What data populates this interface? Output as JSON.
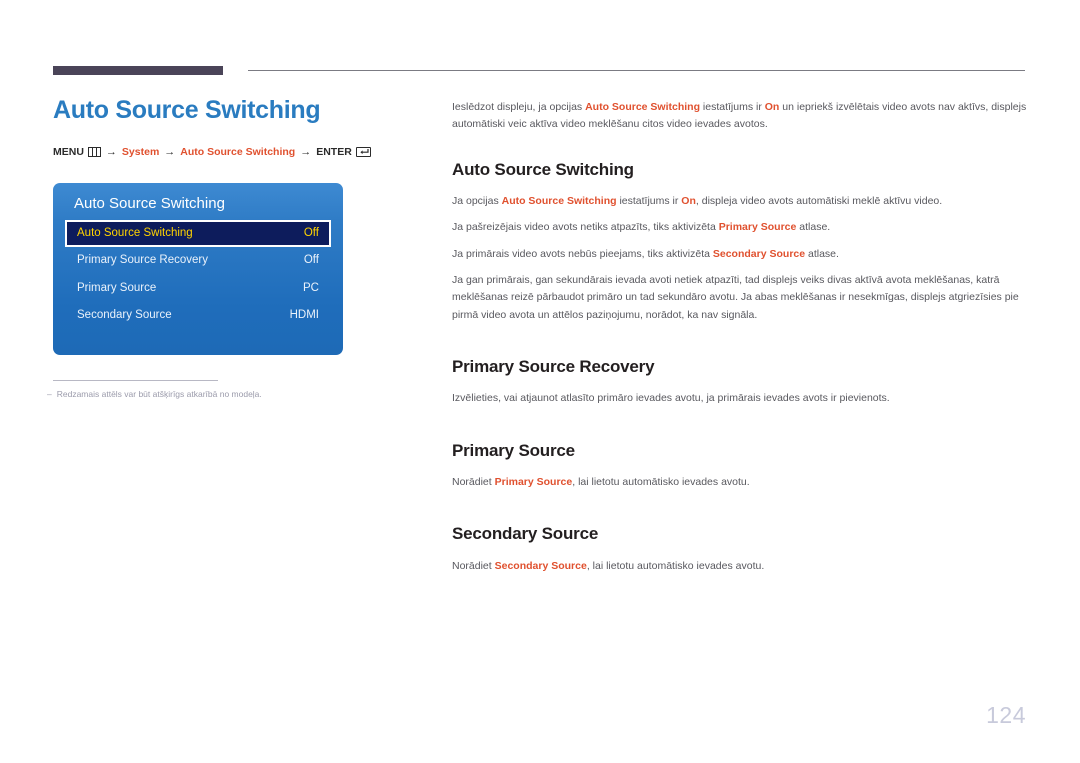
{
  "page": {
    "title": "Auto Source Switching",
    "number": "124"
  },
  "breadcrumb": {
    "menu_label": "MENU",
    "menu_icon": "menu-grid-icon",
    "arrow": "→",
    "step1": "System",
    "step2": "Auto Source Switching",
    "enter_label": "ENTER",
    "enter_icon": "enter-return-icon"
  },
  "osd": {
    "title": "Auto Source Switching",
    "rows": [
      {
        "label": "Auto Source Switching",
        "value": "Off",
        "selected": true
      },
      {
        "label": "Primary Source Recovery",
        "value": "Off",
        "selected": false
      },
      {
        "label": "Primary Source",
        "value": "PC",
        "selected": false
      },
      {
        "label": "Secondary Source",
        "value": "HDMI",
        "selected": false
      }
    ]
  },
  "footnote": {
    "dash": "–",
    "text": "Redzamais attēls var būt atšķirīgs atkarībā no modeļa."
  },
  "content": {
    "intro": {
      "p1": "Ieslēdzot displeju, ja opcijas ",
      "hl1": "Auto Source Switching",
      "p2": " iestatījums ir ",
      "hl2": "On",
      "p3": " un iepriekš izvēlētais video avots nav aktīvs, displejs automātiski veic aktīva video meklēšanu citos video ievades avotos."
    },
    "sections": [
      {
        "heading": "Auto Source Switching",
        "line1_a": "Ja opcijas ",
        "line1_hl1": "Auto Source Switching",
        "line1_b": " iestatījums ir ",
        "line1_hl2": "On",
        "line1_c": ", displeja video avots automātiski meklē aktīvu video.",
        "line2_a": "Ja pašreizējais video avots netiks atpazīts, tiks aktivizēta ",
        "line2_hl": "Primary Source",
        "line2_b": " atlase.",
        "line3_a": "Ja primārais video avots nebūs pieejams, tiks aktivizēta ",
        "line3_hl": "Secondary Source",
        "line3_b": " atlase.",
        "para": "Ja gan primārais, gan sekundārais ievada avoti netiek atpazīti, tad displejs veiks divas aktīvā avota meklēšanas, katrā meklēšanas reizē pārbaudot primāro un tad sekundāro avotu. Ja abas meklēšanas ir nesekmīgas, displejs atgriezīsies pie pirmā video avota un attēlos paziņojumu, norādot, ka nav signāla."
      },
      {
        "heading": "Primary Source Recovery",
        "body": "Izvēlieties, vai atjaunot atlasīto primāro ievades avotu, ja primārais ievades avots ir pievienots."
      },
      {
        "heading": "Primary Source",
        "body_a": "Norādiet ",
        "body_hl": "Primary Source",
        "body_b": ", lai lietotu automātisko ievades avotu."
      },
      {
        "heading": "Secondary Source",
        "body_a": "Norādiet ",
        "body_hl": "Secondary Source",
        "body_b": ", lai lietotu automātisko ievades avotu."
      }
    ]
  },
  "colors": {
    "title_blue": "#2a7cc0",
    "accent_orange": "#e0512f",
    "osd_blue": "#2f7cc6",
    "osd_selected_bg": "#0d1c5c",
    "osd_selected_text": "#ffd400",
    "top_bar": "#4a4458",
    "page_number": "#c8cadb"
  }
}
